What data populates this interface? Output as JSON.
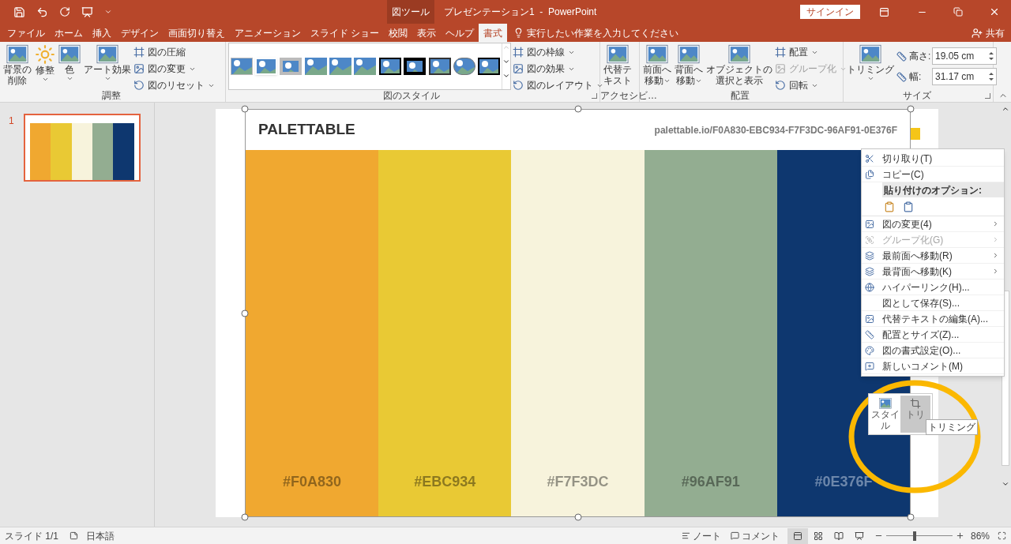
{
  "title_bar": {
    "context_label": "図ツール",
    "title": "プレゼンテーション1  -  PowerPoint",
    "sign_in": "サインイン"
  },
  "tabs": [
    {
      "label": "ファイル",
      "selected": false
    },
    {
      "label": "ホーム",
      "selected": false
    },
    {
      "label": "挿入",
      "selected": false
    },
    {
      "label": "デザイン",
      "selected": false
    },
    {
      "label": "画面切り替え",
      "selected": false
    },
    {
      "label": "アニメーション",
      "selected": false
    },
    {
      "label": "スライド ショー",
      "selected": false
    },
    {
      "label": "校閲",
      "selected": false
    },
    {
      "label": "表示",
      "selected": false
    },
    {
      "label": "ヘルプ",
      "selected": false
    },
    {
      "label": "書式",
      "selected": true
    }
  ],
  "tell_me": {
    "placeholder": "実行したい作業を入力してください"
  },
  "share": "共有",
  "ribbon": {
    "groups": [
      {
        "label": "調整",
        "launcher": false,
        "items": [
          {
            "kind": "large",
            "lines": [
              "背景の",
              "削除"
            ],
            "dropdown": false
          },
          {
            "kind": "large",
            "lines": [
              "修整"
            ],
            "dropdown": true
          },
          {
            "kind": "large",
            "lines": [
              "色"
            ],
            "dropdown": true
          },
          {
            "kind": "large",
            "lines": [
              "アート効果"
            ],
            "dropdown": true
          },
          {
            "kind": "stack",
            "items": [
              {
                "label": "図の圧縮",
                "dropdown": false,
                "disabled": false
              },
              {
                "label": "図の変更",
                "dropdown": true,
                "disabled": false
              },
              {
                "label": "図のリセット",
                "dropdown": true,
                "disabled": false
              }
            ]
          }
        ]
      },
      {
        "label": "図のスタイル",
        "launcher": true,
        "items": [
          {
            "kind": "gallery"
          },
          {
            "kind": "stack",
            "items": [
              {
                "label": "図の枠線",
                "dropdown": true,
                "disabled": false
              },
              {
                "label": "図の効果",
                "dropdown": true,
                "disabled": false
              },
              {
                "label": "図のレイアウト",
                "dropdown": true,
                "disabled": false
              }
            ]
          }
        ]
      },
      {
        "label": "アクセシビ…",
        "launcher": false,
        "items": [
          {
            "kind": "large",
            "lines": [
              "代替テ",
              "キスト"
            ],
            "dropdown": false
          }
        ]
      },
      {
        "label": "配置",
        "launcher": false,
        "items": [
          {
            "kind": "large",
            "lines": [
              "前面へ",
              "移動"
            ],
            "dropdown": true
          },
          {
            "kind": "large",
            "lines": [
              "背面へ",
              "移動"
            ],
            "dropdown": true
          },
          {
            "kind": "large",
            "lines": [
              "オブジェクトの",
              "選択と表示"
            ],
            "dropdown": false
          },
          {
            "kind": "stack",
            "items": [
              {
                "label": "配置",
                "dropdown": true,
                "disabled": false
              },
              {
                "label": "グループ化",
                "dropdown": true,
                "disabled": true
              },
              {
                "label": "回転",
                "dropdown": true,
                "disabled": false
              }
            ]
          }
        ]
      },
      {
        "label": "サイズ",
        "launcher": true,
        "items": [
          {
            "kind": "large",
            "lines": [
              "トリミング"
            ],
            "dropdown": true
          },
          {
            "kind": "fields",
            "items": [
              {
                "label": "高さ:",
                "value": "19.05 cm"
              },
              {
                "label": "幅:",
                "value": "31.17 cm"
              }
            ]
          }
        ]
      }
    ]
  },
  "slides": [
    {
      "number": "1",
      "selected": true
    }
  ],
  "slide": {
    "title": "PALETTABLE",
    "url": "palettable.io/F0A830-EBC934-F7F3DC-96AF91-0E376F",
    "columns": [
      {
        "label": "#F0A830",
        "color": "#f0a830"
      },
      {
        "label": "#EBC934",
        "color": "#e9c934"
      },
      {
        "label": "#F7F3DC",
        "color": "#f7f3dc"
      },
      {
        "label": "#96AF91",
        "color": "#93ad91"
      },
      {
        "label": "#0E376F",
        "color": "#0e376f"
      }
    ]
  },
  "context_menu": [
    {
      "kind": "item",
      "label": "切り取り(T)",
      "disabled": false,
      "submenu": false
    },
    {
      "kind": "item",
      "label": "コピー(C)",
      "disabled": false,
      "submenu": false
    },
    {
      "kind": "header",
      "label": "貼り付けのオプション:"
    },
    {
      "kind": "paste"
    },
    {
      "kind": "item",
      "label": "図の変更(4)",
      "disabled": false,
      "submenu": true
    },
    {
      "kind": "item",
      "label": "グループ化(G)",
      "disabled": true,
      "submenu": true
    },
    {
      "kind": "item",
      "label": "最前面へ移動(R)",
      "disabled": false,
      "submenu": true
    },
    {
      "kind": "item",
      "label": "最背面へ移動(K)",
      "disabled": false,
      "submenu": true
    },
    {
      "kind": "item",
      "label": "ハイパーリンク(H)...",
      "disabled": false,
      "submenu": false
    },
    {
      "kind": "item",
      "label": "図として保存(S)...",
      "disabled": false,
      "submenu": false
    },
    {
      "kind": "item",
      "label": "代替テキストの編集(A)...",
      "disabled": false,
      "submenu": false
    },
    {
      "kind": "item",
      "label": "配置とサイズ(Z)...",
      "disabled": false,
      "submenu": false
    },
    {
      "kind": "item",
      "label": "図の書式設定(O)...",
      "disabled": false,
      "submenu": false
    },
    {
      "kind": "item",
      "label": "新しいコメント(M)",
      "disabled": false,
      "submenu": false
    }
  ],
  "mini_toolbar": {
    "buttons": [
      {
        "lines": [
          "スタイ",
          "ル"
        ],
        "hovered": false
      },
      {
        "lines": [
          "トリ"
        ],
        "hovered": true
      }
    ],
    "tooltip": "トリミング"
  },
  "status_bar": {
    "slide_counter": "スライド 1/1",
    "language": "日本語",
    "notes": "ノート",
    "comments": "コメント",
    "views": [
      {
        "selected": true
      },
      {
        "selected": false
      },
      {
        "selected": false
      },
      {
        "selected": false
      }
    ],
    "zoom": {
      "level": 0.43,
      "reading": "86%"
    }
  }
}
